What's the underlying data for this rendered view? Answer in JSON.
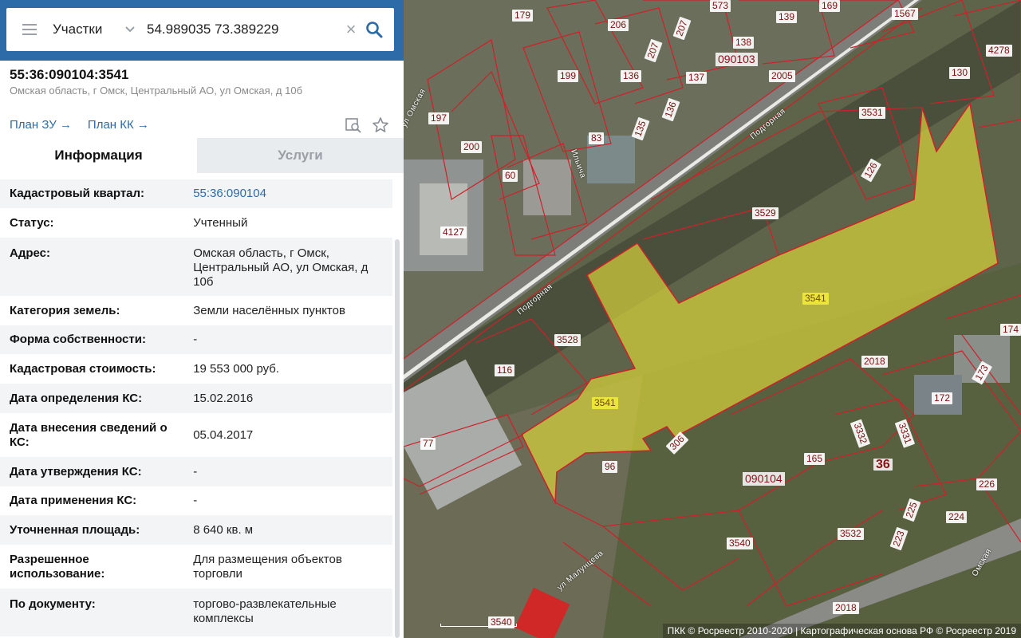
{
  "search": {
    "type_label": "Участки",
    "query": "54.989035 73.389229"
  },
  "object": {
    "number": "55:36:090104:3541",
    "address": "Омская область, г Омск, Центральный АО, ул Омская, д 10б",
    "links": {
      "plan_zu": "План ЗУ",
      "plan_kk": "План КК"
    }
  },
  "tabs": [
    {
      "label": "Информация"
    },
    {
      "label": "Услуги"
    }
  ],
  "info": {
    "rows": [
      {
        "label": "Кадастровый квартал:",
        "value": "55:36:090104"
      },
      {
        "label": "Статус:",
        "value": "Учтенный"
      },
      {
        "label": "Адрес:",
        "value": "Омская область, г Омск, Центральный АО, ул Омская, д 10б"
      },
      {
        "label": "Категория земель:",
        "value": "Земли населённых пунктов"
      },
      {
        "label": "Форма собственности:",
        "value": "-"
      },
      {
        "label": "Кадастровая стоимость:",
        "value": "19 553 000 руб."
      },
      {
        "label": "Дата определения КС:",
        "value": "15.02.2016"
      },
      {
        "label": "Дата внесения сведений о КС:",
        "value": "05.04.2017"
      },
      {
        "label": "Дата утверждения КС:",
        "value": "-"
      },
      {
        "label": "Дата применения КС:",
        "value": "-"
      },
      {
        "label": "Уточненная площадь:",
        "value": "8 640 кв. м"
      },
      {
        "label": "Разрешенное использование:",
        "value": "Для размещения объектов торговли"
      },
      {
        "label": "По документу:",
        "value": "торгово-развлекательные комплексы"
      }
    ]
  },
  "map": {
    "selected_parcel": "3541",
    "parcel_labels": [
      "179",
      "206",
      "207",
      "573",
      "139",
      "169",
      "1567",
      "4278",
      "138",
      "090103",
      "207",
      "199",
      "136",
      "137",
      "2005",
      "130",
      "197",
      "136",
      "135",
      "3531",
      "200",
      "83",
      "60",
      "126",
      "3529",
      "4127",
      "3541",
      "3528",
      "174",
      "116",
      "2018",
      "173",
      "3541",
      "172",
      "3332",
      "3331",
      "306",
      "77",
      "96",
      "165",
      "36",
      "090104",
      "226",
      "225",
      "224",
      "223",
      "3532",
      "3540",
      "2018",
      "3540"
    ],
    "streets": [
      "ул Омская",
      "Подгорная",
      "Подгорная",
      "Ильича",
      "ул Малунцева",
      "Омская"
    ],
    "attribution": "ПКК © Росреестр 2010-2020 | Картографическая основа РФ © Росреестр 2019",
    "colors": {
      "selection": "#e8e23a",
      "boundary": "#d0202a",
      "header": "#2d6aa8"
    }
  }
}
